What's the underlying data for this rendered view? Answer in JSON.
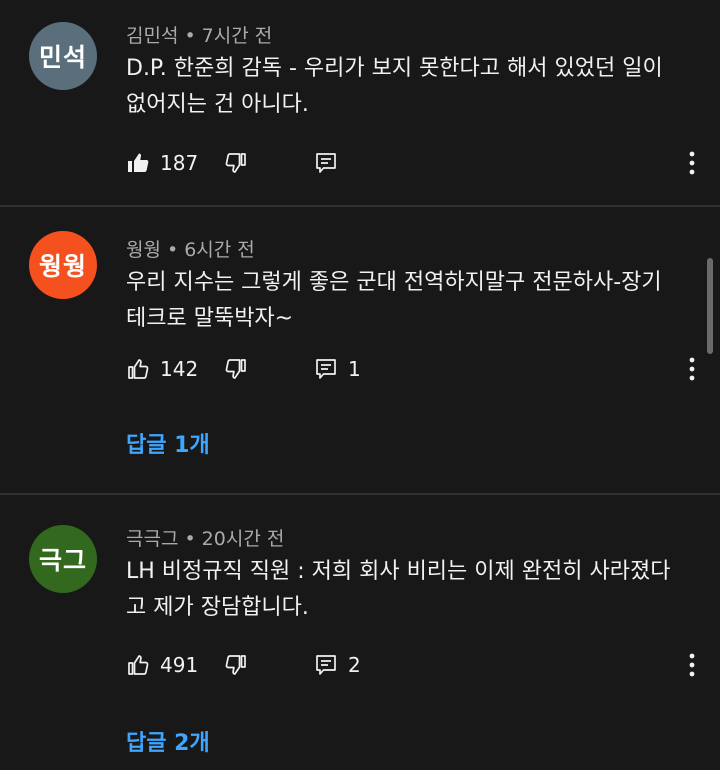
{
  "comments": [
    {
      "avatar_text": "민석",
      "avatar_color": "#5a6f7b",
      "author": "김민석",
      "time": "7시간 전",
      "text_line1": "D.P. 한준희 감독 - 우리가 보지 못한다고 해서 있었던 일이",
      "text_line2": "없어지는 건 아니다.",
      "likes": "187",
      "liked": true,
      "reply_count": "",
      "replies_label": ""
    },
    {
      "avatar_text": "웡웡",
      "avatar_color": "#f4511e",
      "author": "웡웡",
      "time": "6시간 전",
      "text_line1": "우리 지수는 그렇게 좋은 군대 전역하지말구 전문하사-장기",
      "text_line2": "테크로 말뚝박자~",
      "likes": "142",
      "liked": false,
      "reply_count": "1",
      "replies_label": "답글 1개"
    },
    {
      "avatar_text": "극그",
      "avatar_color": "#33691e",
      "author": "극극그",
      "time": "20시간 전",
      "text_line1": "LH 비정규직 직원 : 저희 회사 비리는 이제 완전히 사라졌다",
      "text_line2": "고 제가 장담합니다.",
      "likes": "491",
      "liked": false,
      "reply_count": "2",
      "replies_label": "답글 2개"
    }
  ],
  "separator": "•",
  "icons": {
    "like": "thumbs-up-icon",
    "dislike": "thumbs-down-icon",
    "reply": "comment-icon",
    "more": "more-vertical-icon"
  },
  "colors": {
    "background": "#181818",
    "link": "#3ea6ff",
    "meta": "#aaaaaa"
  }
}
